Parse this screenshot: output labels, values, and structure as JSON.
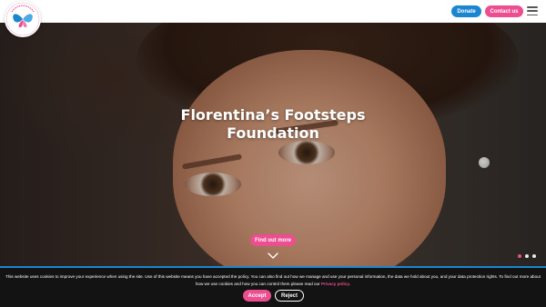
{
  "header": {
    "logo_text": "Florentina's Footsteps Foundation",
    "donate_label": "Donate",
    "contact_label": "Contact us",
    "menu_icon": "hamburger-icon"
  },
  "hero": {
    "title_line1": "Florentina’s Footsteps",
    "title_line2": "Foundation",
    "cta_label": "Find out more",
    "scroll_icon": "chevron-down-icon",
    "slides_count": 3,
    "active_slide": 1
  },
  "cookie": {
    "text_main": "This website uses cookies to improve your experience when using the site. Use of this website means you have accepted the policy. You can also find out how we manage and use your personal information, the data we hold about you, and your data protection rights. To find out more about how we use cookies and how you can control them please read our ",
    "policy_link": "Privacy policy",
    "text_end": ".",
    "accept_label": "Accept",
    "reject_label": "Reject"
  },
  "colors": {
    "brand_pink": "#ec4e8f",
    "brand_blue": "#1a86d0",
    "cookie_bg": "#131313"
  }
}
